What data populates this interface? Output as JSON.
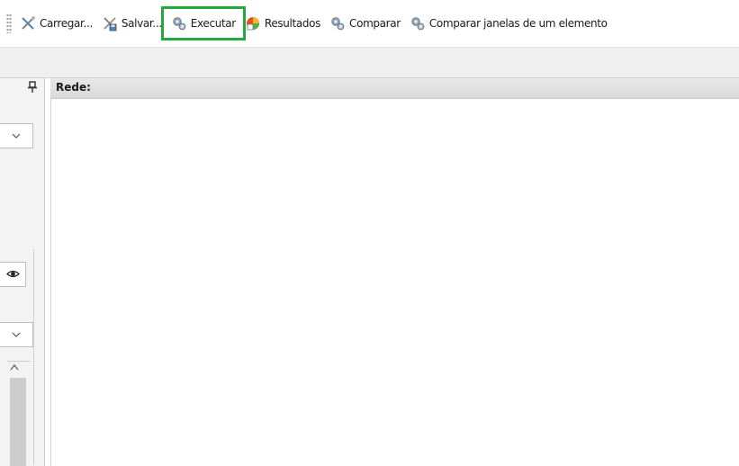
{
  "toolbar": {
    "items": [
      {
        "label": "Carregar...",
        "icon": "tools-icon"
      },
      {
        "label": "Salvar...",
        "icon": "save-tools-icon"
      },
      {
        "label": "Executar",
        "icon": "gears-icon",
        "highlighted": true
      },
      {
        "label": "Resultados",
        "icon": "results-icon"
      },
      {
        "label": "Comparar",
        "icon": "gears-icon"
      },
      {
        "label": "Comparar janelas de um elemento",
        "icon": "gears-icon"
      }
    ]
  },
  "main": {
    "title": "Rede:"
  },
  "colors": {
    "highlight": "#22a83d"
  }
}
